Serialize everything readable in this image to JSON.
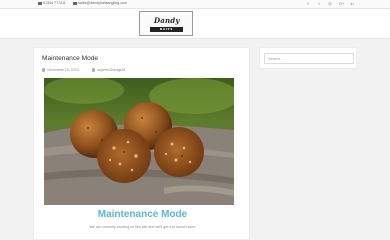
{
  "topbar": {
    "phone": "01344 777411",
    "email": "sales@dandybaitsangling.com",
    "social_icons": [
      "facebook-icon",
      "twitter-icon",
      "instagram-icon",
      "google-plus-icon",
      "linkedin-icon"
    ],
    "social_glyphs": [
      "f",
      "t",
      "◎",
      "G+",
      "in"
    ]
  },
  "header": {
    "logo_text": "Dandy",
    "logo_sub": "BAITS"
  },
  "post": {
    "title": "Maintenance Mode",
    "date": "November 19, 2024",
    "author": "superful3xsdgs28",
    "heading": "Maintenance Mode",
    "text": "We are currently working on this site and we'll get it to launch soon"
  },
  "sidebar": {
    "search_placeholder": "Search ..."
  },
  "colors": {
    "accent": "#5bb7d6",
    "page_bg": "#f2f2f2"
  }
}
